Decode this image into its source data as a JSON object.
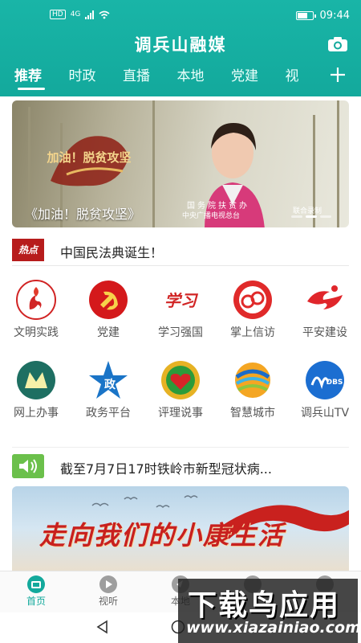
{
  "status_bar": {
    "hd_label": "HD",
    "network": "4G",
    "time": "09:44"
  },
  "header": {
    "app_title": "调兵山融媒",
    "tabs": [
      {
        "label": "推荐"
      },
      {
        "label": "时政"
      },
      {
        "label": "直播"
      },
      {
        "label": "本地"
      },
      {
        "label": "党建"
      },
      {
        "label": "视"
      }
    ],
    "active_tab": "推荐",
    "accent_color": "#13a99c"
  },
  "banner": {
    "caption": "《加油！脱贫攻坚》",
    "stamp_text": "加油！脱贫攻坚",
    "overlay_line1": "国务院扶贫办",
    "overlay_line2": "中央广播电视总台",
    "overlay_line3": "联合录制"
  },
  "hot_news": {
    "badge": "热点",
    "title": "中国民法典诞生！"
  },
  "services": [
    [
      {
        "label": "文明实践",
        "icon": "civilization-practice-icon"
      },
      {
        "label": "党建",
        "icon": "party-emblem-icon"
      },
      {
        "label": "学习强国",
        "icon": "xuexi-qiangguo-icon"
      },
      {
        "label": "掌上信访",
        "icon": "petition-icon"
      },
      {
        "label": "平安建设",
        "icon": "safety-icon"
      }
    ],
    [
      {
        "label": "网上办事",
        "icon": "online-service-icon"
      },
      {
        "label": "政务平台",
        "icon": "government-platform-icon"
      },
      {
        "label": "评理说事",
        "icon": "mediation-icon"
      },
      {
        "label": "智慧城市",
        "icon": "smart-city-icon"
      },
      {
        "label": "调兵山TV",
        "icon": "tv-icon"
      }
    ]
  ],
  "notice": {
    "title": "截至7月7日17时铁岭市新型冠状病..."
  },
  "banner2": {
    "slogan": "走向我们的小康生活"
  },
  "bottom_nav": [
    {
      "label": "首页",
      "active": true
    },
    {
      "label": "视听",
      "active": false
    },
    {
      "label": "本地",
      "active": false
    },
    {
      "label": "",
      "active": false
    },
    {
      "label": "",
      "active": false
    }
  ],
  "watermark": {
    "title": "下载鸟应用",
    "url": "www.xiazainiao.com"
  }
}
